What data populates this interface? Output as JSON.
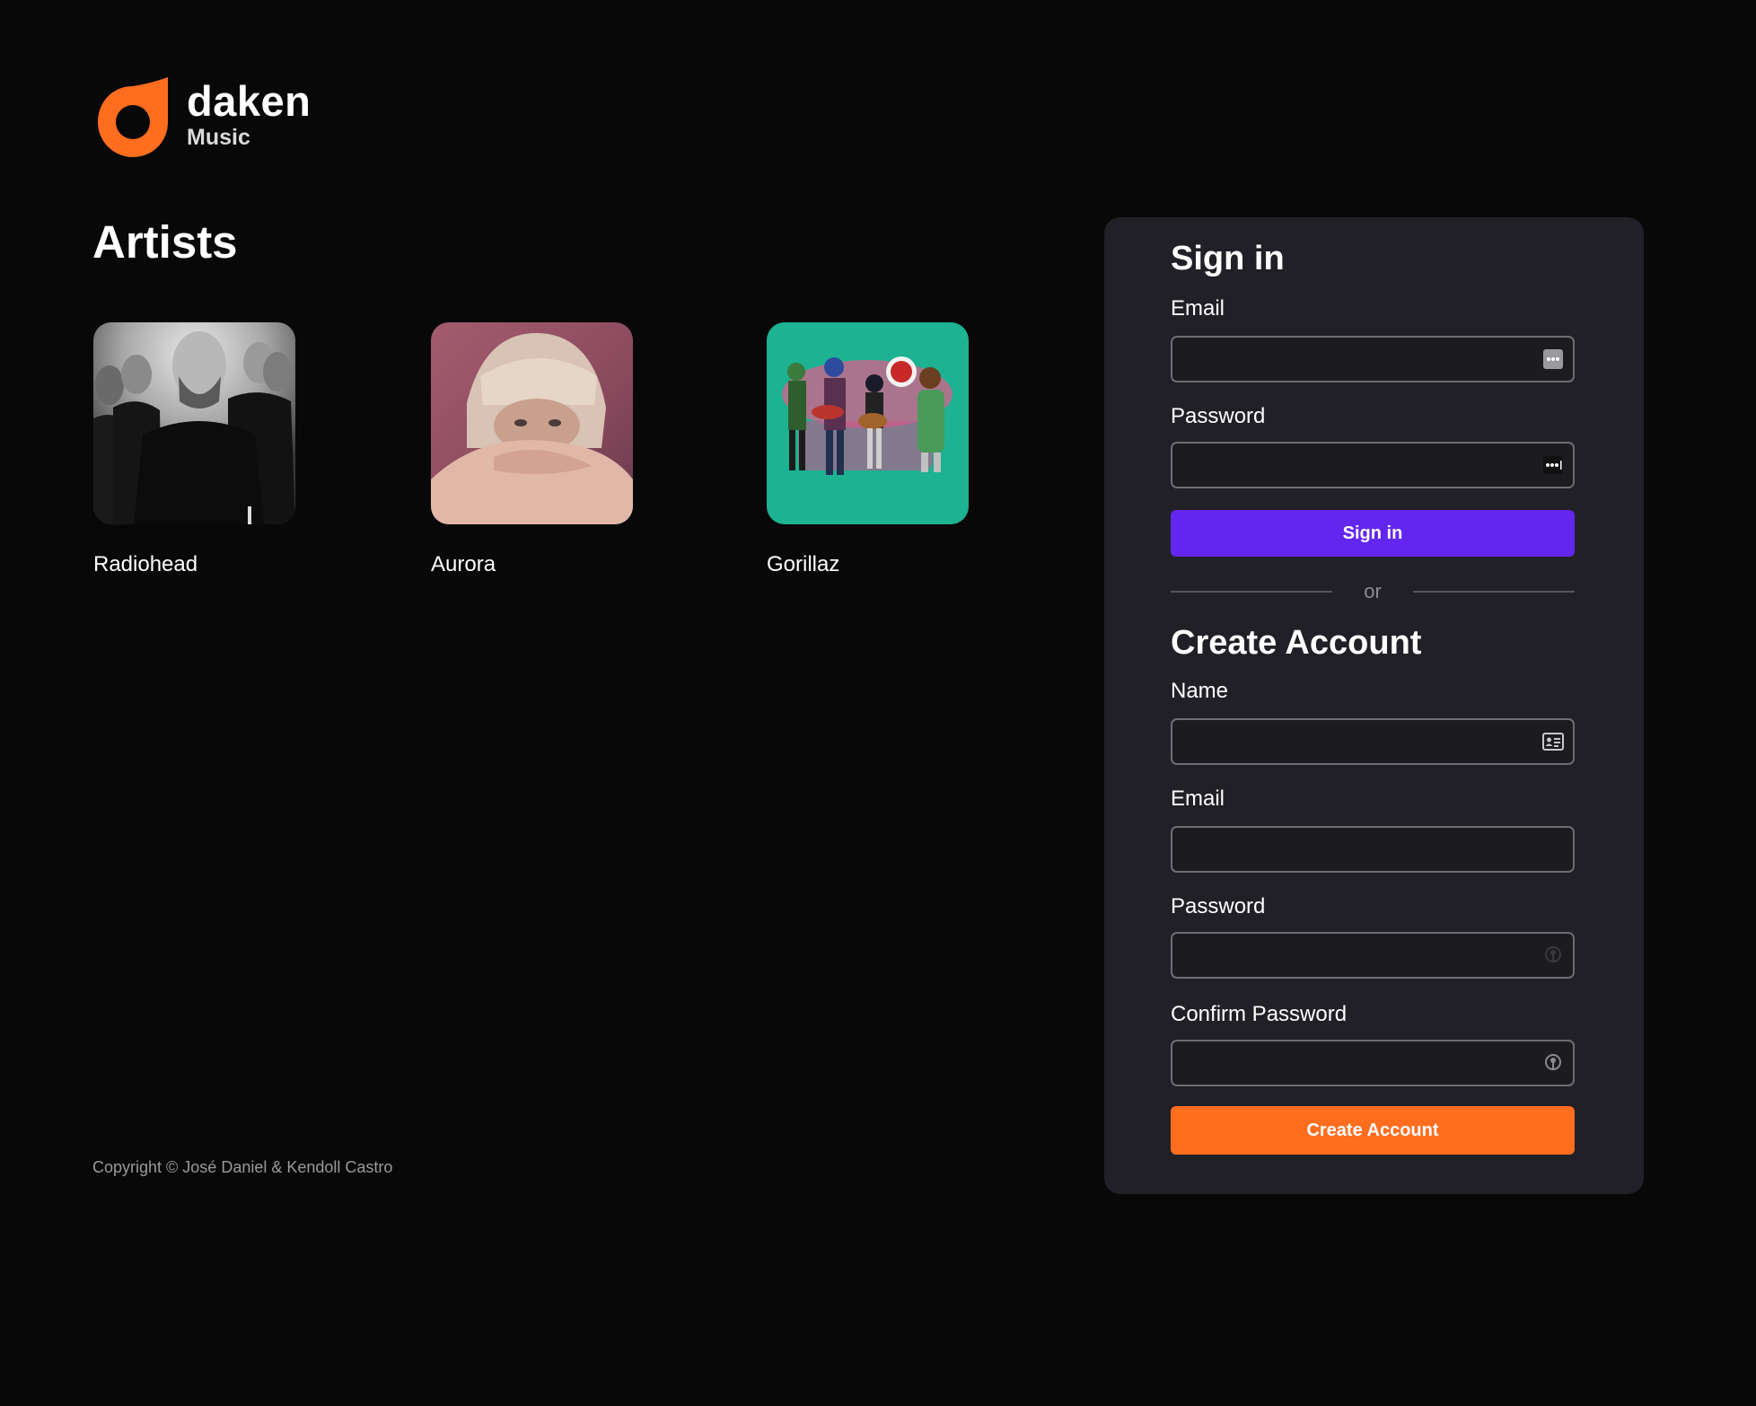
{
  "brand": {
    "name": "daken",
    "sub": "Music",
    "accent": "#ff6d1f"
  },
  "artists_section": {
    "title": "Artists",
    "items": [
      {
        "name": "Radiohead",
        "image": "radiohead-photo"
      },
      {
        "name": "Aurora",
        "image": "aurora-photo"
      },
      {
        "name": "Gorillaz",
        "image": "gorillaz-art"
      }
    ]
  },
  "footer": {
    "copyright": "Copyright © José Daniel & Kendoll Castro"
  },
  "signin": {
    "title": "Sign in",
    "email_label": "Email",
    "email_value": "",
    "email_icon": "more-dots-icon",
    "password_label": "Password",
    "password_value": "",
    "password_icon": "password-dots-icon",
    "button_label": "Sign in",
    "button_color": "#6326ee"
  },
  "divider": {
    "text": "or"
  },
  "create_account": {
    "title": "Create Account",
    "name_label": "Name",
    "name_value": "",
    "name_icon": "contact-card-icon",
    "email_label": "Email",
    "email_value": "",
    "password_label": "Password",
    "password_value": "",
    "password_icon": "key-lock-icon",
    "confirm_label": "Confirm Password",
    "confirm_value": "",
    "confirm_icon": "key-lock-icon",
    "button_label": "Create Account",
    "button_color": "#ff6d1f"
  }
}
